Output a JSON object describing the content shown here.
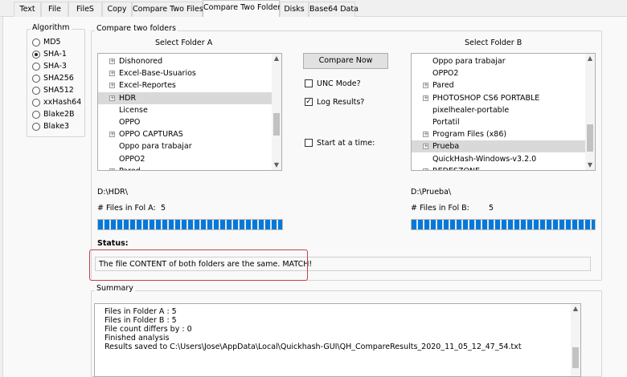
{
  "tabs": [
    "Text",
    "File",
    "FileS",
    "Copy",
    "Compare Two Files",
    "Compare Two Folders",
    "Disks",
    "Base64 Data"
  ],
  "active_tab": "Compare Two Folders",
  "algorithm": {
    "title": "Algorithm",
    "options": [
      "MD5",
      "SHA-1",
      "SHA-3",
      "SHA256",
      "SHA512",
      "xxHash64",
      "Blake2B",
      "Blake3"
    ],
    "selected": "SHA-1"
  },
  "compare": {
    "group_title": "Compare two folders",
    "folder_a": {
      "heading": "Select Folder A",
      "items": [
        {
          "label": "Dishonored",
          "expandable": true
        },
        {
          "label": "Excel-Base-Usuarios",
          "expandable": true
        },
        {
          "label": "Excel-Reportes",
          "expandable": true
        },
        {
          "label": "HDR",
          "expandable": true,
          "selected": true
        },
        {
          "label": "License",
          "expandable": false
        },
        {
          "label": "OPPO",
          "expandable": false
        },
        {
          "label": "OPPO CAPTURAS",
          "expandable": true
        },
        {
          "label": "Oppo para trabajar",
          "expandable": false
        },
        {
          "label": "OPPO2",
          "expandable": false
        },
        {
          "label": "Pared",
          "expandable": true
        }
      ],
      "path": "D:\\HDR\\",
      "files_label": "# Files in Fol A:",
      "files_count": "5",
      "progress": 1.0
    },
    "folder_b": {
      "heading": "Select Folder B",
      "items": [
        {
          "label": "Oppo para trabajar",
          "expandable": false
        },
        {
          "label": "OPPO2",
          "expandable": false
        },
        {
          "label": "Pared",
          "expandable": true
        },
        {
          "label": "PHOTOSHOP CS6 PORTABLE",
          "expandable": true
        },
        {
          "label": "pixelhealer-portable",
          "expandable": false
        },
        {
          "label": "Portatil",
          "expandable": false
        },
        {
          "label": "Program Files (x86)",
          "expandable": true
        },
        {
          "label": "Prueba",
          "expandable": true,
          "selected": true
        },
        {
          "label": "QuickHash-Windows-v3.2.0",
          "expandable": false
        },
        {
          "label": "REDESZONE",
          "expandable": true
        }
      ],
      "path": "D:\\Prueba\\",
      "files_label": "# Files in Fol B:",
      "files_count": "5",
      "progress": 1.0
    },
    "compare_button": "Compare Now",
    "unc_mode": {
      "label": "UNC Mode?",
      "checked": false
    },
    "log_results": {
      "label": "Log Results?",
      "checked": true
    },
    "start_at_time": {
      "label": "Start at a time:",
      "checked": false
    },
    "status_label": "Status:",
    "status_text": "The file CONTENT of both folders are the same. MATCH!"
  },
  "summary": {
    "title": "Summary",
    "lines": [
      "Files in Folder A : 5",
      "Files in Folder B : 5",
      "File count differs by : 0",
      "Finished analysis",
      "Results saved to C:\\Users\\Jose\\AppData\\Local\\Quickhash-GUI\\QH_CompareResults_2020_11_05_12_47_54.txt"
    ]
  },
  "colors": {
    "progress": "#0778d8",
    "highlight": "#c0414d",
    "selected_row": "#d9d9d9"
  }
}
